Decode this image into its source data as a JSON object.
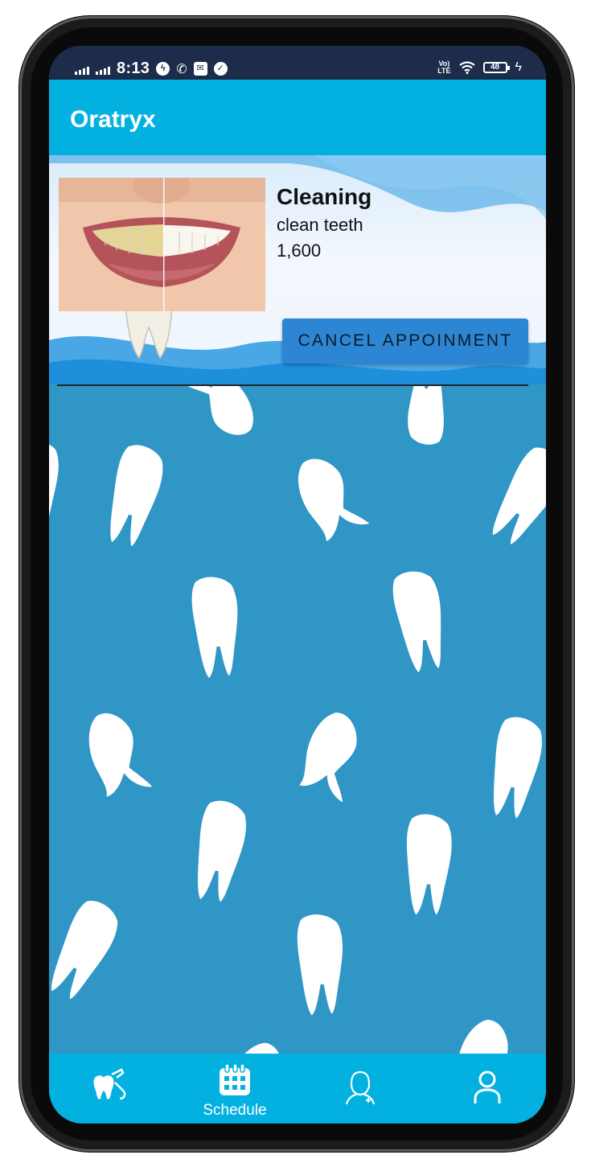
{
  "status_bar": {
    "time": "8:13",
    "network": "VoLTE",
    "battery": "48"
  },
  "app": {
    "title": "Oratryx"
  },
  "appointment": {
    "service": "Cleaning",
    "description": "clean teeth",
    "price": "1,600",
    "image": "teeth-whitening-smile",
    "cancel_label": "CANCEL APPOINMENT"
  },
  "bottom_nav": {
    "items": [
      {
        "icon": "tooth-tools-icon",
        "label": ""
      },
      {
        "icon": "calendar-icon",
        "label": "Schedule",
        "selected": true
      },
      {
        "icon": "doctor-icon",
        "label": ""
      },
      {
        "icon": "profile-icon",
        "label": ""
      }
    ]
  },
  "colors": {
    "app_bar": "#03b1e1",
    "status_bar": "#1c2c4a",
    "background": "#2f96c6",
    "button": "#2d86d4"
  }
}
